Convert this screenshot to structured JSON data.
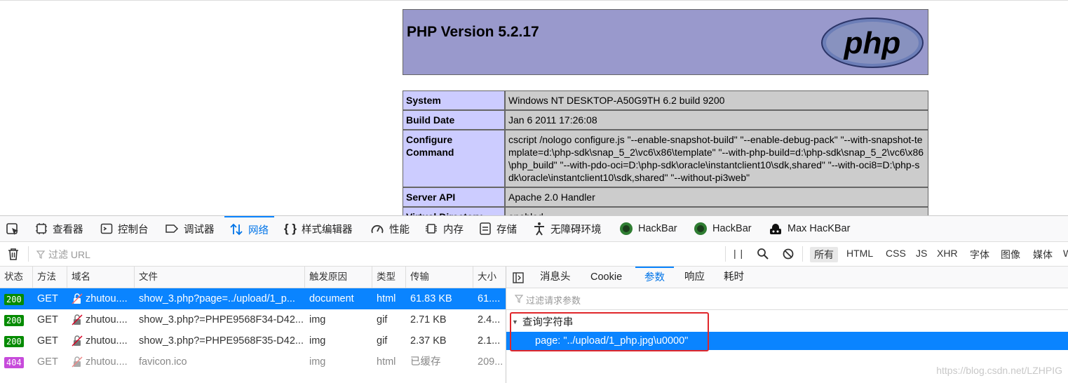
{
  "phpinfo": {
    "title": "PHP Version 5.2.17",
    "logo_text": "php",
    "rows": [
      {
        "key": "System",
        "value": "Windows NT DESKTOP-A50G9TH 6.2 build 9200"
      },
      {
        "key": "Build Date",
        "value": "Jan 6 2011 17:26:08"
      },
      {
        "key": "Configure Command",
        "value": "cscript /nologo configure.js \"--enable-snapshot-build\" \"--enable-debug-pack\" \"--with-snapshot-template=d:\\php-sdk\\snap_5_2\\vc6\\x86\\template\" \"--with-php-build=d:\\php-sdk\\snap_5_2\\vc6\\x86\\php_build\" \"--with-pdo-oci=D:\\php-sdk\\oracle\\instantclient10\\sdk,shared\" \"--with-oci8=D:\\php-sdk\\oracle\\instantclient10\\sdk,shared\" \"--without-pi3web\""
      },
      {
        "key": "Server API",
        "value": "Apache 2.0 Handler"
      },
      {
        "key": "Virtual Directory",
        "value": "enabled"
      }
    ]
  },
  "devtools": {
    "tabs": [
      {
        "label": "查看器"
      },
      {
        "label": "控制台"
      },
      {
        "label": "调试器"
      },
      {
        "label": "网络"
      },
      {
        "label": "样式编辑器"
      },
      {
        "label": "性能"
      },
      {
        "label": "内存"
      },
      {
        "label": "存储"
      },
      {
        "label": "无障碍环境"
      },
      {
        "label": "HackBar"
      },
      {
        "label": "HackBar"
      },
      {
        "label": "Max HacKBar"
      }
    ],
    "filter_placeholder": "过滤 URL",
    "pause_label": "| |",
    "type_filters": [
      "所有",
      "HTML",
      "CSS",
      "JS",
      "XHR",
      "字体",
      "图像",
      "媒体",
      "W"
    ],
    "columns": [
      "状态",
      "方法",
      "域名",
      "文件",
      "触发原因",
      "类型",
      "传输",
      "大小"
    ],
    "requests": [
      {
        "status": "200",
        "method": "GET",
        "domain": "zhutou....",
        "file": "show_3.php?page=../upload/1_p...",
        "cause": "document",
        "type": "html",
        "transfer": "61.83 KB",
        "size": "61...."
      },
      {
        "status": "200",
        "method": "GET",
        "domain": "zhutou....",
        "file": "show_3.php?=PHPE9568F34-D42...",
        "cause": "img",
        "type": "gif",
        "transfer": "2.71 KB",
        "size": "2.4..."
      },
      {
        "status": "200",
        "method": "GET",
        "domain": "zhutou....",
        "file": "show_3.php?=PHPE9568F35-D42...",
        "cause": "img",
        "type": "gif",
        "transfer": "2.37 KB",
        "size": "2.1..."
      },
      {
        "status": "404",
        "method": "GET",
        "domain": "zhutou....",
        "file": "favicon.ico",
        "cause": "img",
        "type": "html",
        "transfer": "已缓存",
        "size": "209..."
      }
    ],
    "detail_tabs": [
      "消息头",
      "Cookie",
      "参数",
      "响应",
      "耗时"
    ],
    "param_filter_placeholder": "过滤请求参数",
    "query_string_label": "查询字符串",
    "query_param": "page: \"../upload/1_php.jpg\\u0000\""
  },
  "watermark": "https://blog.csdn.net/LZHPIG",
  "colors": {
    "accent": "#0a84ff",
    "php_header": "#9999cc",
    "php_key": "#ccccff",
    "php_value": "#cccccc",
    "status_ok": "#058b00",
    "status_404": "#c74bdb",
    "highlight_box": "#e0262a"
  }
}
